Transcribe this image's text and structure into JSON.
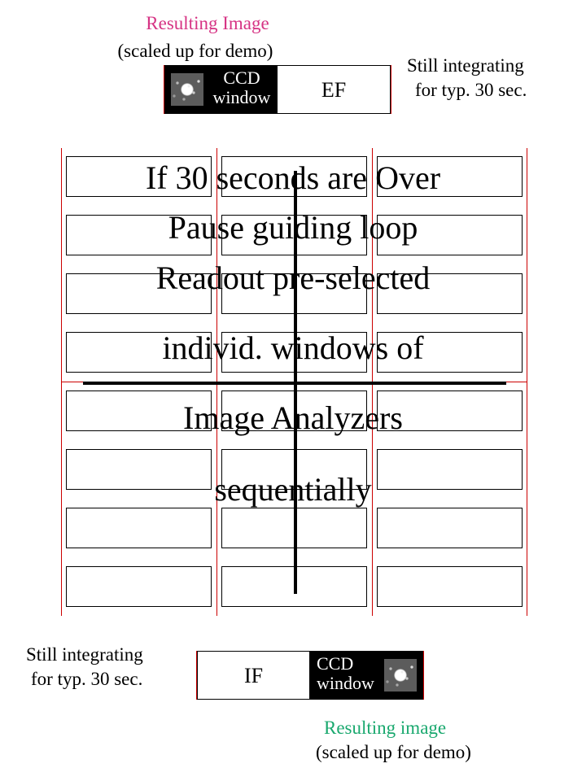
{
  "labels": {
    "result_top": "Resulting Image",
    "result_top_sub": "(scaled up for demo)",
    "result_bottom": "Resulting image",
    "result_bottom_sub": "(scaled up for demo)",
    "still_integrating": "Still integrating",
    "still_integrating_sub": "for typ. 30 sec.",
    "ccd_window_1": "CCD",
    "ccd_window_2": "window",
    "ef": "EF",
    "if": "IF",
    "overlay_line1": "If 30 seconds are Over",
    "overlay_line2": "Pause guiding loop",
    "overlay_line3a": "Readout pre-selected",
    "overlay_line3b": "individ. windows of",
    "overlay_line3c": "Image Analyzers",
    "overlay_line3d": "sequentially"
  },
  "colors": {
    "pink": "#d63384",
    "green": "#19a86e",
    "red": "#c00000"
  }
}
